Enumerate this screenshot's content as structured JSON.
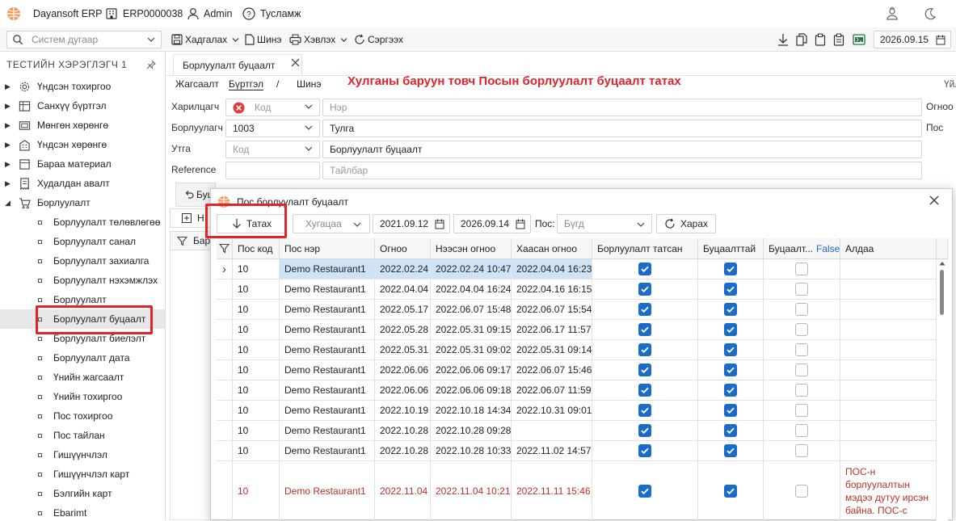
{
  "topbar": {
    "app_title": "Dayansoft ERP",
    "company": "ERP0000038",
    "user": "Admin",
    "help": "Тусламж"
  },
  "toolbar": {
    "system_search_placeholder": "Систем дугаар",
    "save": "Хадгалах",
    "new": "Шинэ",
    "print": "Хэвлэх",
    "refresh": "Сэргээх",
    "date": "2026.09.15"
  },
  "sidebar": {
    "title": "ТЕСТИЙН ХЭРЭГЛЭГЧ 1",
    "groups": [
      {
        "label": "Үндсэн тохиргоо",
        "icon": "gear-icon",
        "expanded": false
      },
      {
        "label": "Санхүү бүртгэл",
        "icon": "ledger-icon",
        "expanded": false
      },
      {
        "label": "Мөнгөн хөрөнгө",
        "icon": "cash-icon",
        "expanded": false
      },
      {
        "label": "Үндсэн хөрөнгө",
        "icon": "building-icon",
        "expanded": false
      },
      {
        "label": "Бараа материал",
        "icon": "box-icon",
        "expanded": false
      },
      {
        "label": "Худалдан авалт",
        "icon": "receipt-icon",
        "expanded": false
      },
      {
        "label": "Борлуулалт",
        "icon": "cart-icon",
        "expanded": true
      }
    ],
    "children": [
      "Борлуулалт төлөвлөгөө",
      "Борлуулалт санал",
      "Борлуулалт захиалга",
      "Борлуулалт нэхэмжлэх",
      "Борлуулалт",
      "Борлуулалт буцаалт",
      "Борлуулалт биелэлт",
      "Борлуулалт дата",
      "Үнийн жагсаалт",
      "Үнийн тохиргоо",
      "Пос тохиргоо",
      "Пос тайлан",
      "Гишүүнчлэл",
      "Гишүүнчлэл карт",
      "Бэлгийн карт",
      "Ebarimt"
    ],
    "selected_child": "Борлуулалт буцаалт"
  },
  "main": {
    "tab_title": "Борлуулалт буцаалт",
    "subnav": {
      "list": "Жагсаалт",
      "register": "Бүртгэл",
      "sep": "/",
      "new": "Шинэ"
    },
    "instruction": "Хулганы баруун товч Посын борлуулалт буцаалт татах",
    "cut_right_label": "Үйл",
    "form": {
      "customer_label": "Харилцагч",
      "customer_code_ph": "Код",
      "customer_name_ph": "Нэр",
      "seller_label": "Борлуулагч",
      "seller_code": "1003",
      "seller_name": "Тулга",
      "context_label": "Утга",
      "context_code_ph": "Код",
      "context_value": "Борлуулалт буцаалт",
      "reference_label": "Reference",
      "reference_desc_ph": "Тайлбар",
      "date_label": "Огноо",
      "pos_label": "Пос"
    },
    "under_tab_partial": "Буц",
    "under_new_partial": "Н",
    "under_grid_partial": "Бар"
  },
  "dialog": {
    "title": "Пос борлуулалт буцаалт",
    "pull_button": "Татах",
    "period_placeholder": "Хугацаа",
    "date_from": "2021.09.12",
    "date_to": "2026.09.14",
    "pos_label": "Пос:",
    "pos_placeholder": "Бүгд",
    "view_button": "Харах",
    "columns": [
      "Пос код",
      "Пос нэр",
      "Огноо",
      "Нээсэн огноо",
      "Хаасан огноо",
      "Борлуулалт татсан",
      "Буцаалттай",
      "Буцаалт...",
      "Алдаа"
    ],
    "filter_value": "False",
    "rows": [
      {
        "code": "10",
        "name": "Demo Restaurant1",
        "date": "2022.02.24",
        "opened": "2022.02.24 10:47",
        "closed": "2022.04.04 16:23",
        "pulled": true,
        "has_return": true,
        "returned": false,
        "error": "",
        "error_row": false,
        "current": true
      },
      {
        "code": "10",
        "name": "Demo Restaurant1",
        "date": "2022.04.04",
        "opened": "2022.04.04 16:24",
        "closed": "2022.04.16 16:15",
        "pulled": true,
        "has_return": true,
        "returned": false,
        "error": "",
        "error_row": false,
        "current": false
      },
      {
        "code": "10",
        "name": "Demo Restaurant1",
        "date": "2022.05.17",
        "opened": "2022.06.07 15:48",
        "closed": "2022.06.07 15:54",
        "pulled": true,
        "has_return": true,
        "returned": false,
        "error": "",
        "error_row": false,
        "current": false
      },
      {
        "code": "10",
        "name": "Demo Restaurant1",
        "date": "2022.05.28",
        "opened": "2022.05.31 09:15",
        "closed": "2022.06.17 11:57",
        "pulled": true,
        "has_return": true,
        "returned": false,
        "error": "",
        "error_row": false,
        "current": false
      },
      {
        "code": "10",
        "name": "Demo Restaurant1",
        "date": "2022.05.31",
        "opened": "2022.05.31 09:02",
        "closed": "2022.05.31 09:14",
        "pulled": true,
        "has_return": true,
        "returned": false,
        "error": "",
        "error_row": false,
        "current": false
      },
      {
        "code": "10",
        "name": "Demo Restaurant1",
        "date": "2022.06.06",
        "opened": "2022.06.06 09:17",
        "closed": "2022.06.07 15:46",
        "pulled": true,
        "has_return": true,
        "returned": false,
        "error": "",
        "error_row": false,
        "current": false
      },
      {
        "code": "10",
        "name": "Demo Restaurant1",
        "date": "2022.06.06",
        "opened": "2022.06.06 09:18",
        "closed": "2022.06.07 11:59",
        "pulled": true,
        "has_return": true,
        "returned": false,
        "error": "",
        "error_row": false,
        "current": false
      },
      {
        "code": "10",
        "name": "Demo Restaurant1",
        "date": "2022.10.19",
        "opened": "2022.10.18 14:34",
        "closed": "2022.10.31 09:01",
        "pulled": true,
        "has_return": true,
        "returned": false,
        "error": "",
        "error_row": false,
        "current": false
      },
      {
        "code": "10",
        "name": "Demo Restaurant1",
        "date": "2022.10.28",
        "opened": "2022.10.28 09:28",
        "closed": "",
        "pulled": true,
        "has_return": true,
        "returned": false,
        "error": "",
        "error_row": false,
        "current": false
      },
      {
        "code": "10",
        "name": "Demo Restaurant1",
        "date": "2022.10.28",
        "opened": "2022.10.28 10:33",
        "closed": "2022.11.02 14:57",
        "pulled": true,
        "has_return": true,
        "returned": false,
        "error": "",
        "error_row": false,
        "current": false
      },
      {
        "code": "10",
        "name": "Demo Restaurant1",
        "date": "2022.11.04",
        "opened": "2022.11.04 10:21",
        "closed": "2022.11.11 15:46",
        "pulled": true,
        "has_return": true,
        "returned": false,
        "error": "ПОС-н борлуулалтын мэдээ дутуу ирсэн байна. ПОС-с",
        "error_row": true,
        "current": false
      }
    ]
  },
  "colors": {
    "accent": "#1a6cc8",
    "highlight": "#e1242a",
    "error_text": "#b8322a",
    "selected_row": "#cfe3f7"
  }
}
